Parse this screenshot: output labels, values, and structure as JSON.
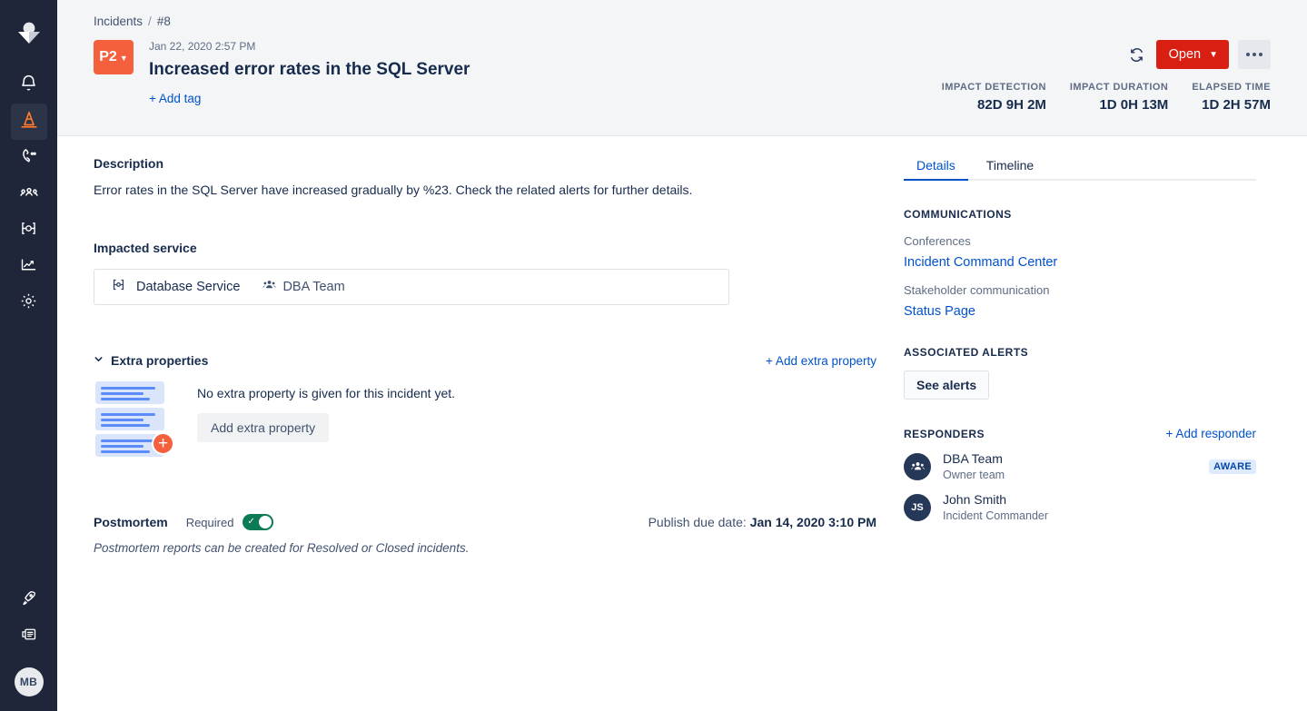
{
  "nav": {
    "logo": "opsgenie-logo-icon",
    "items": [
      {
        "name": "alerts",
        "icon": "bell-icon",
        "active": false
      },
      {
        "name": "incidents",
        "icon": "traffic-cone-icon",
        "active": true
      },
      {
        "name": "on-call",
        "icon": "phone-icon",
        "active": false
      },
      {
        "name": "teams",
        "icon": "people-icon",
        "active": false
      },
      {
        "name": "services",
        "icon": "service-icon",
        "active": false
      },
      {
        "name": "analytics",
        "icon": "chart-line-icon",
        "active": false
      },
      {
        "name": "settings",
        "icon": "gear-icon",
        "active": false
      }
    ],
    "bottom": [
      {
        "name": "whats-new",
        "icon": "rocket-icon"
      },
      {
        "name": "docs",
        "icon": "document-icon"
      }
    ],
    "avatar_initials": "MB"
  },
  "header": {
    "breadcrumb_root": "Incidents",
    "breadcrumb_sep": "/",
    "breadcrumb_current": "#8",
    "priority": "P2",
    "timestamp": "Jan 22, 2020 2:57 PM",
    "title": "Increased error rates in the SQL Server",
    "add_tag_label": "+ Add tag",
    "refresh_icon": "refresh-icon",
    "status_label": "Open",
    "more_icon": "ellipsis-icon",
    "metrics": [
      {
        "label": "IMPACT DETECTION",
        "value": "82D 9H 2M"
      },
      {
        "label": "IMPACT DURATION",
        "value": "1D 0H 13M"
      },
      {
        "label": "ELAPSED TIME",
        "value": "1D 2H 57M"
      }
    ]
  },
  "content": {
    "description_title": "Description",
    "description_text": "Error rates in the SQL Server have increased gradually by %23. Check the related alerts for further details.",
    "impacted_title": "Impacted service",
    "service_name": "Database Service",
    "service_team": "DBA Team",
    "extra_properties_title": "Extra properties",
    "add_extra_property_link": "+ Add extra property",
    "extra_empty_text": "No extra property is given for this incident yet.",
    "add_extra_property_button": "Add extra property",
    "postmortem_title": "Postmortem",
    "postmortem_required_label": "Required",
    "postmortem_toggle_on": true,
    "publish_due_label": "Publish due date:",
    "publish_due_value": "Jan 14, 2020 3:10 PM",
    "postmortem_note": "Postmortem reports can be created for Resolved or Closed incidents."
  },
  "rightpane": {
    "tabs": [
      {
        "label": "Details",
        "active": true
      },
      {
        "label": "Timeline",
        "active": false
      }
    ],
    "communications_title": "COMMUNICATIONS",
    "conferences_label": "Conferences",
    "conference_link": "Incident Command Center",
    "stakeholder_label": "Stakeholder communication",
    "stakeholder_link": "Status Page",
    "associated_alerts_title": "ASSOCIATED ALERTS",
    "see_alerts_button": "See alerts",
    "responders_title": "RESPONDERS",
    "add_responder_link": "+ Add responder",
    "responders": [
      {
        "avatar_type": "team",
        "initials": "",
        "name": "DBA Team",
        "role": "Owner team",
        "badge": "AWARE"
      },
      {
        "avatar_type": "user",
        "initials": "JS",
        "name": "John Smith",
        "role": "Incident Commander",
        "badge": ""
      }
    ]
  },
  "colors": {
    "priority_p2": "#f4603e",
    "status_open": "#d91f11",
    "link": "#0052cc",
    "nav_bg": "#1f2639",
    "toggle_on": "#0b7a55",
    "badge_bg": "#deebff",
    "badge_text": "#0747a6"
  }
}
